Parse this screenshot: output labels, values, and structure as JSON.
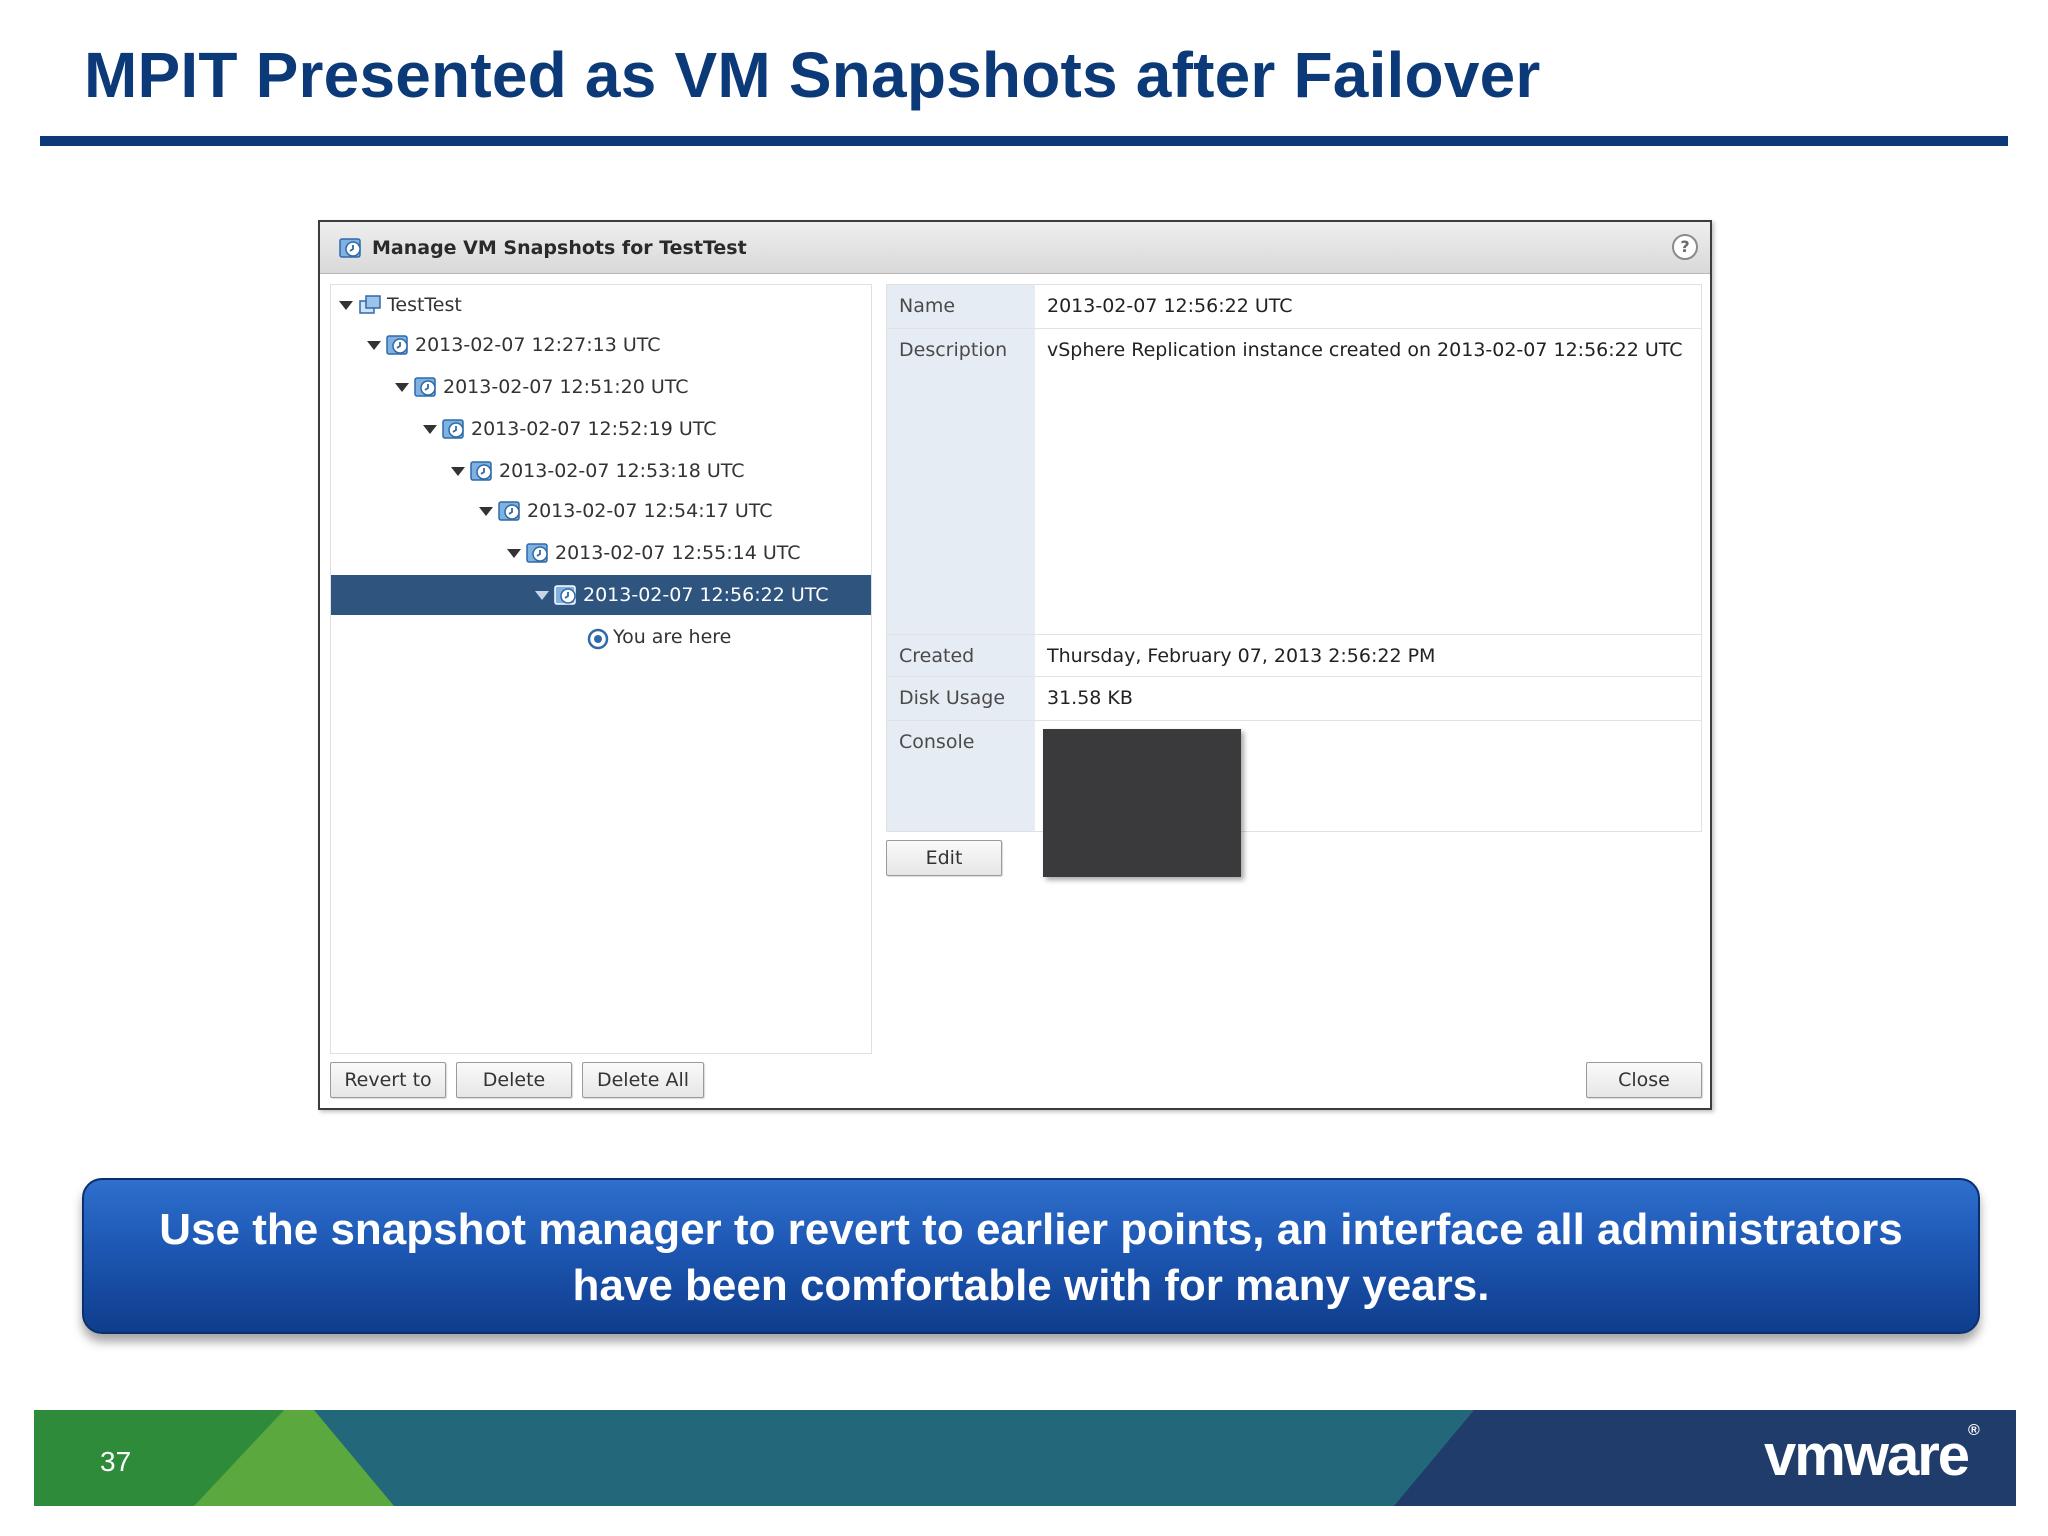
{
  "slide": {
    "title": "MPIT Presented as VM Snapshots after Failover",
    "page_number": "37",
    "callout_line1": "Use the snapshot manager to revert to earlier points, an interface all administrators",
    "callout_line2": "have been comfortable with for many years.",
    "logo_text": "vmware",
    "logo_mark": "®"
  },
  "dialog": {
    "title": "Manage VM Snapshots for TestTest",
    "help_label": "?",
    "tree": {
      "root": "TestTest",
      "snapshots": [
        "2013-02-07 12:27:13 UTC",
        "2013-02-07 12:51:20 UTC",
        "2013-02-07 12:52:19 UTC",
        "2013-02-07 12:53:18 UTC",
        "2013-02-07 12:54:17 UTC",
        "2013-02-07 12:55:14 UTC",
        "2013-02-07 12:56:22 UTC"
      ],
      "selected_index": 6,
      "you_are_here": "You are here"
    },
    "details": {
      "name_label": "Name",
      "name_value": "2013-02-07 12:56:22 UTC",
      "description_label": "Description",
      "description_value": "vSphere Replication instance created on 2013-02-07 12:56:22 UTC",
      "created_label": "Created",
      "created_value": "Thursday, February 07, 2013 2:56:22 PM",
      "disk_usage_label": "Disk Usage",
      "disk_usage_value": "31.58 KB",
      "console_label": "Console"
    },
    "buttons": {
      "edit": "Edit",
      "revert_to": "Revert to",
      "delete": "Delete",
      "delete_all": "Delete All",
      "close": "Close"
    }
  },
  "colors": {
    "title_blue": "#0c3a78",
    "selected_row": "#2f557f",
    "callout_blue": "#1d57b3",
    "footer_green": "#2e8b3a",
    "footer_teal": "#23687a",
    "footer_navy": "#203c6a"
  }
}
